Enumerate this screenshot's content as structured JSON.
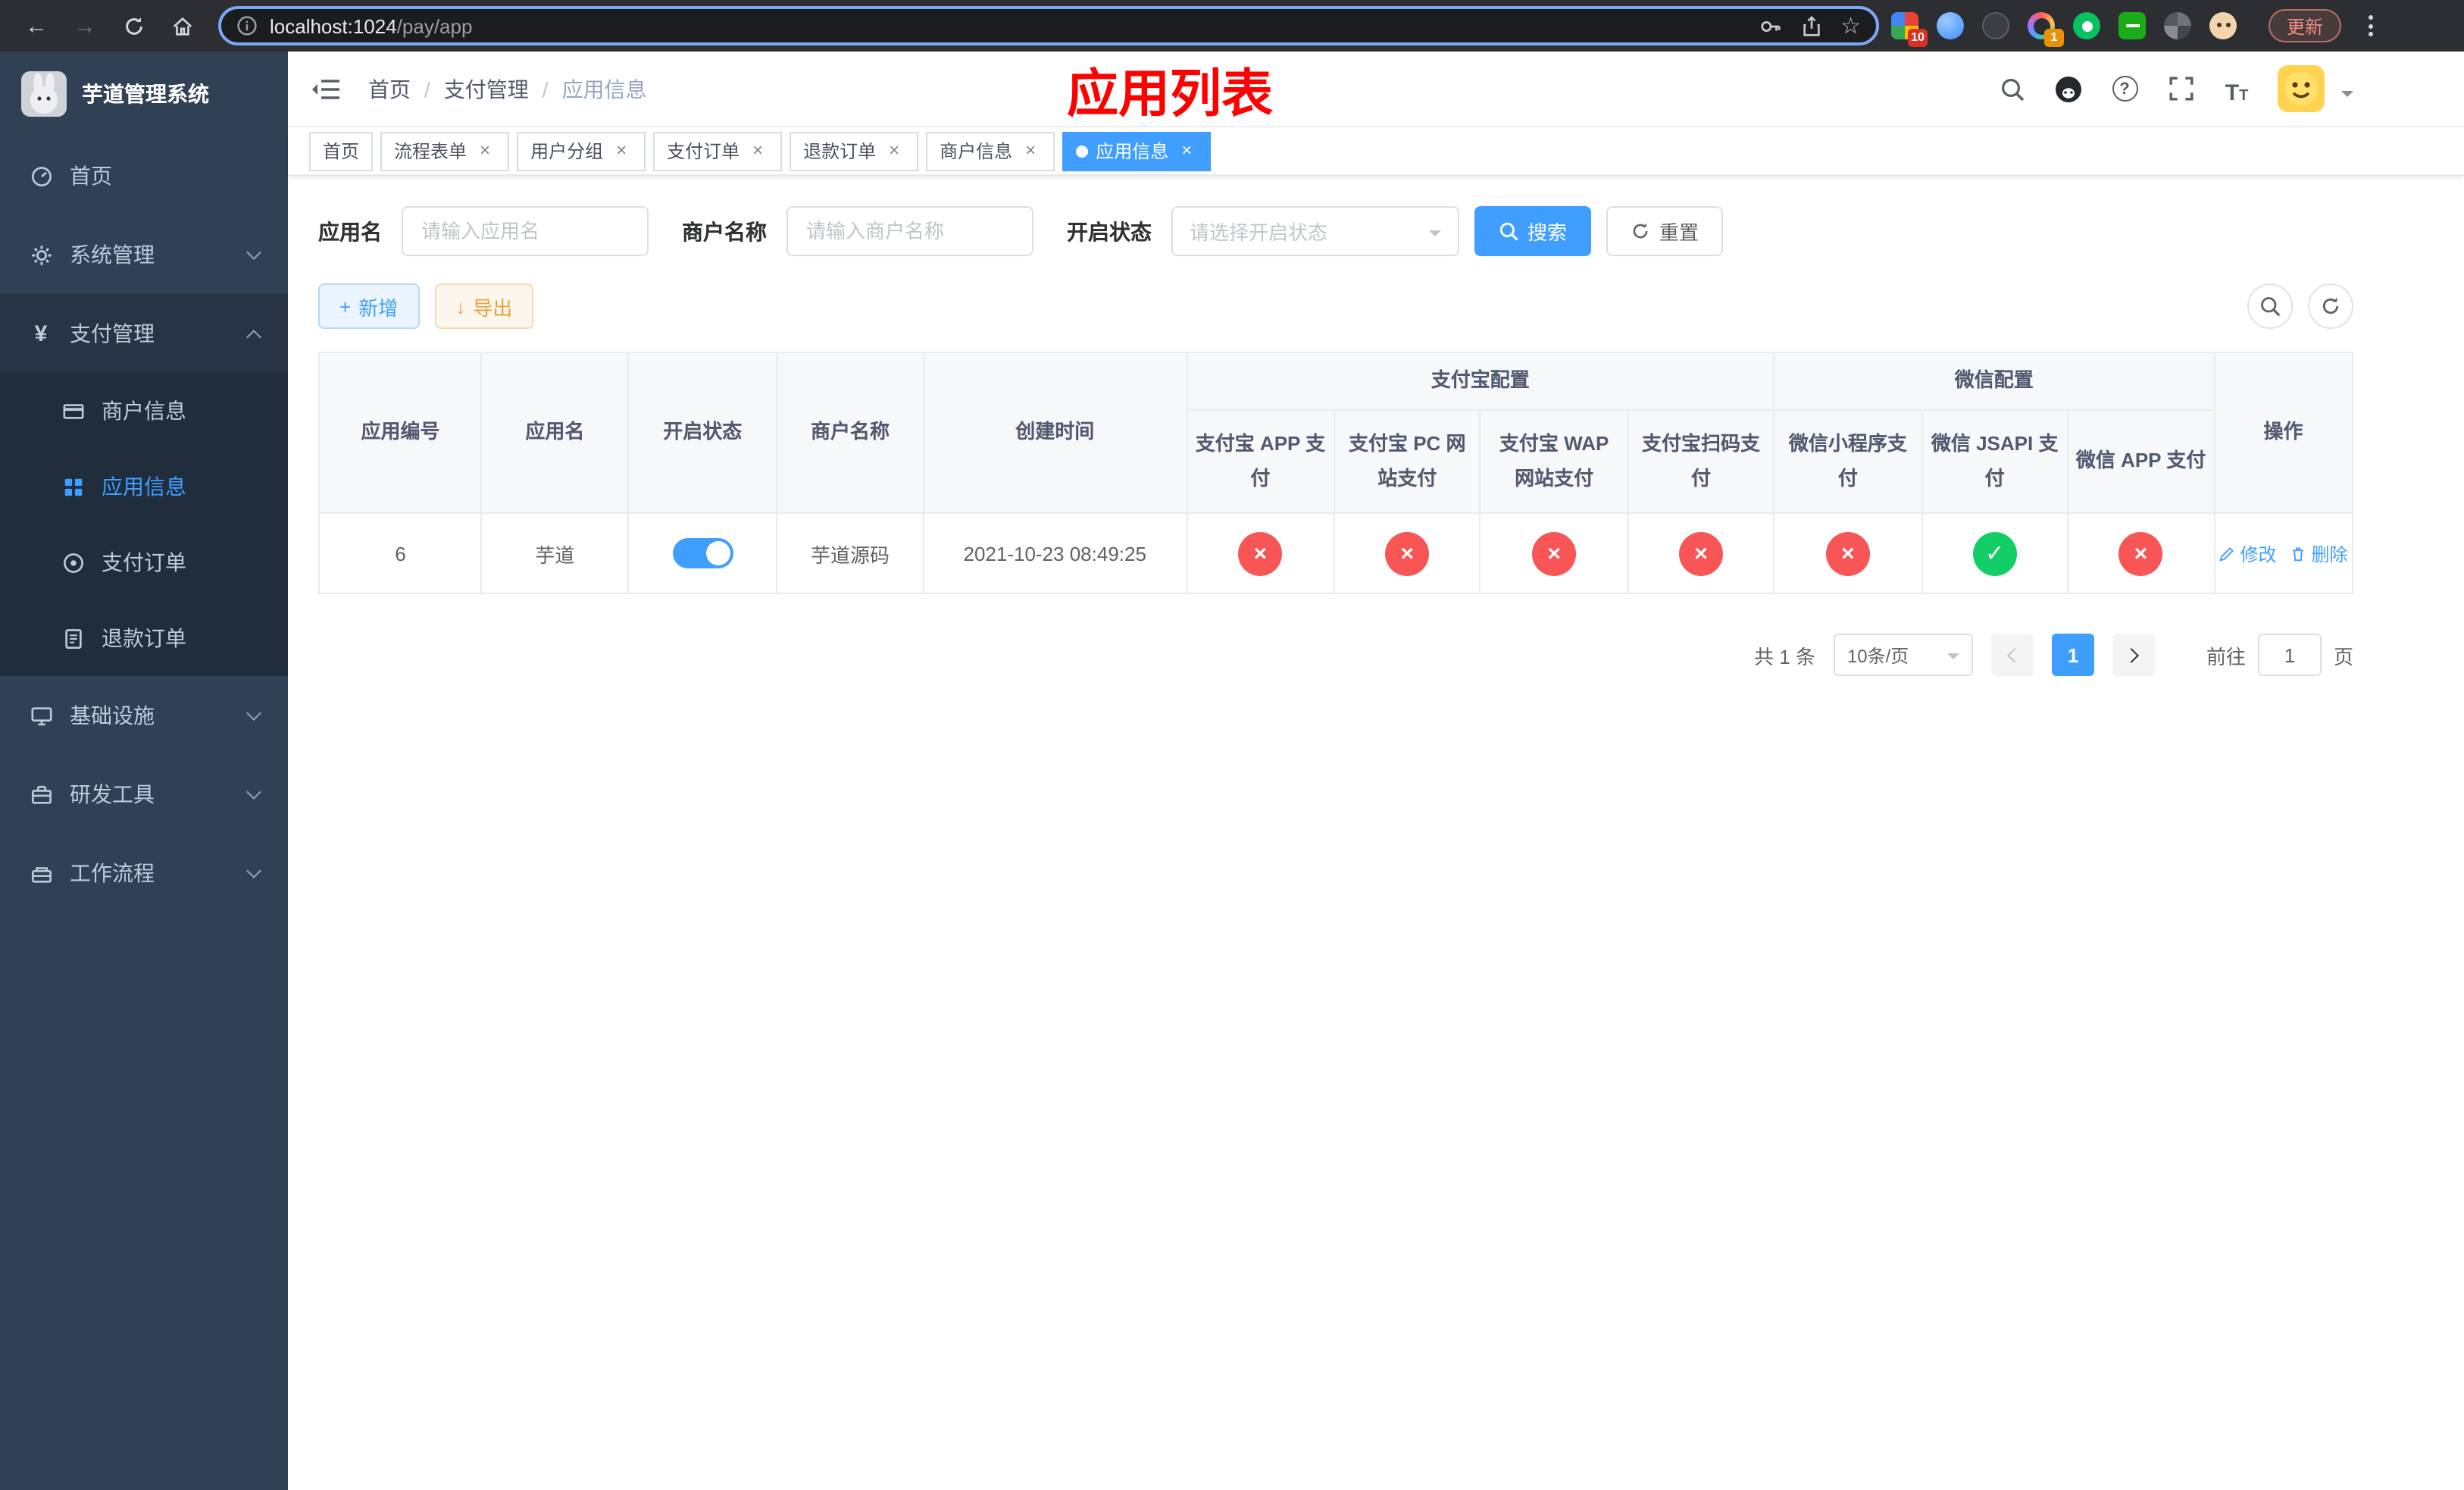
{
  "browser": {
    "url_host": "localhost:1024",
    "url_path": "/pay/app",
    "update_label": "更新",
    "extension_badge_1": "10",
    "extension_badge_2": "1"
  },
  "icons": {
    "back": "←",
    "forward": "→",
    "star": "☆",
    "close": "×",
    "cross": "×",
    "check": "✓",
    "plus": "+",
    "download": "↓",
    "question": "?",
    "sep": "/",
    "yen": "¥",
    "font_big": "T",
    "font_small": "T"
  },
  "colors": {
    "accent": "#409eff",
    "status_off": "#f85656",
    "status_on": "#13ce66",
    "annotation": "#ff0000",
    "sidebar_bg": "#304156",
    "submenu_bg": "#1f2d3d"
  },
  "sidebar": {
    "title": "芋道管理系统",
    "items": [
      {
        "label": "首页"
      },
      {
        "label": "系统管理"
      },
      {
        "label": "支付管理",
        "children": [
          {
            "label": "商户信息"
          },
          {
            "label": "应用信息",
            "active": true
          },
          {
            "label": "支付订单"
          },
          {
            "label": "退款订单"
          }
        ]
      },
      {
        "label": "基础设施"
      },
      {
        "label": "研发工具"
      },
      {
        "label": "工作流程"
      }
    ]
  },
  "header": {
    "breadcrumb": [
      "首页",
      "支付管理",
      "应用信息"
    ],
    "annotation": "应用列表"
  },
  "tabs": [
    {
      "label": "首页",
      "closable": false,
      "active": false
    },
    {
      "label": "流程表单",
      "closable": true,
      "active": false
    },
    {
      "label": "用户分组",
      "closable": true,
      "active": false
    },
    {
      "label": "支付订单",
      "closable": true,
      "active": false
    },
    {
      "label": "退款订单",
      "closable": true,
      "active": false
    },
    {
      "label": "商户信息",
      "closable": true,
      "active": false
    },
    {
      "label": "应用信息",
      "closable": true,
      "active": true
    }
  ],
  "filters": {
    "app_name_label": "应用名",
    "app_name_placeholder": "请输入应用名",
    "merchant_label": "商户名称",
    "merchant_placeholder": "请输入商户名称",
    "status_label": "开启状态",
    "status_placeholder": "请选择开启状态",
    "search_label": "搜索",
    "reset_label": "重置"
  },
  "toolbar": {
    "add_label": "新增",
    "export_label": "导出"
  },
  "table": {
    "columns": {
      "app_id": "应用编号",
      "app_name": "应用名",
      "status": "开启状态",
      "merchant": "商户名称",
      "created": "创建时间",
      "alipay_group": "支付宝配置",
      "wechat_group": "微信配置",
      "actions": "操作",
      "alipay_app": "支付宝 APP 支付",
      "alipay_pc": "支付宝 PC 网站支付",
      "alipay_wap": "支付宝 WAP 网站支付",
      "alipay_qr": "支付宝扫码支付",
      "wechat_lite": "微信小程序支付",
      "wechat_jsapi": "微信 JSAPI 支付",
      "wechat_app": "微信 APP 支付"
    },
    "rows": [
      {
        "app_id": "6",
        "app_name": "芋道",
        "status_on": true,
        "merchant": "芋道源码",
        "created": "2021-10-23 08:49:25",
        "alipay_app": false,
        "alipay_pc": false,
        "alipay_wap": false,
        "alipay_qr": false,
        "wechat_lite": false,
        "wechat_jsapi": true,
        "wechat_app": false,
        "edit_label": "修改",
        "delete_label": "删除"
      }
    ]
  },
  "pagination": {
    "total": "共 1 条",
    "page_size": "10条/页",
    "current_page": "1",
    "goto_label": "前往",
    "goto_value": "1",
    "page_unit": "页"
  }
}
